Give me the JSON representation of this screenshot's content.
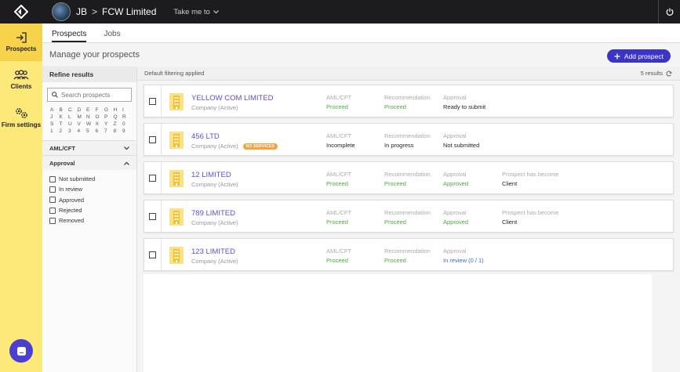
{
  "topbar": {
    "initials": "JB",
    "separator": ">",
    "firm": "FCW Limited",
    "take_me_to": "Take me to"
  },
  "sidebar": {
    "items": [
      {
        "label": "Prospects",
        "icon": "login-arrow-icon",
        "active": true
      },
      {
        "label": "Clients",
        "icon": "users-icon",
        "active": false
      },
      {
        "label": "Firm settings",
        "icon": "gears-icon",
        "active": false
      }
    ]
  },
  "tabs": [
    {
      "label": "Prospects",
      "active": true
    },
    {
      "label": "Jobs",
      "active": false
    }
  ],
  "header": {
    "title": "Manage your prospects",
    "add_button": "Add prospect"
  },
  "refine": {
    "title": "Refine results",
    "search_placeholder": "Search prospects",
    "letters": [
      "A",
      "B",
      "C",
      "D",
      "E",
      "F",
      "G",
      "H",
      "I",
      "J",
      "K",
      "L",
      "M",
      "N",
      "O",
      "P",
      "Q",
      "R",
      "S",
      "T",
      "U",
      "V",
      "W",
      "X",
      "Y",
      "Z",
      "0",
      "1",
      "2",
      "3",
      "4",
      "5",
      "6",
      "7",
      "8",
      "9"
    ],
    "aml_label": "AML/CFT",
    "approval_label": "Approval",
    "approval_options": [
      "Not submitted",
      "In review",
      "Approved",
      "Rejected",
      "Removed"
    ]
  },
  "results": {
    "filter_note": "Default filtering applied",
    "count_text": "5 results"
  },
  "prospects": [
    {
      "name": "YELLOW COM LIMITED",
      "type": "Company (Active)",
      "badge": "",
      "aml_label": "AML/CFT",
      "aml_value": "Proceed",
      "rec_label": "Recommendation",
      "rec_value": "Proceed",
      "approval_label": "Approval",
      "approval_value": "Ready to submit",
      "extra_label": "",
      "extra_value": ""
    },
    {
      "name": "456 LTD",
      "type": "Company (Active)",
      "badge": "NO SERVICES",
      "aml_label": "AML/CFT",
      "aml_value": "Incomplete",
      "rec_label": "Recommendation",
      "rec_value": "In progress",
      "approval_label": "Approval",
      "approval_value": "Not submitted",
      "extra_label": "",
      "extra_value": ""
    },
    {
      "name": "12 LIMITED",
      "type": "Company (Active)",
      "badge": "",
      "aml_label": "AML/CFT",
      "aml_value": "Proceed",
      "rec_label": "Recommendation",
      "rec_value": "Proceed",
      "approval_label": "Approval",
      "approval_value": "Approved",
      "extra_label": "Prospect has become",
      "extra_value": "Client"
    },
    {
      "name": "789 LIMITED",
      "type": "Company (Active)",
      "badge": "",
      "aml_label": "AML/CFT",
      "aml_value": "Proceed",
      "rec_label": "Recommendation",
      "rec_value": "Proceed",
      "approval_label": "Approval",
      "approval_value": "Approved",
      "extra_label": "Prospect has become",
      "extra_value": "Client"
    },
    {
      "name": "123 LIMITED",
      "type": "Company (Active)",
      "badge": "",
      "aml_label": "AML/CFT",
      "aml_value": "Proceed",
      "rec_label": "Recommendation",
      "rec_value": "Proceed",
      "approval_label": "Approval",
      "approval_value": "In review (0 / 1)",
      "extra_label": "",
      "extra_value": ""
    }
  ],
  "colors": {
    "accent": "#3b34c8",
    "sidebar": "#fce97a",
    "sidebar_active": "#f7d24b",
    "proceed": "#4cab3d",
    "link": "#5b4fd6"
  }
}
